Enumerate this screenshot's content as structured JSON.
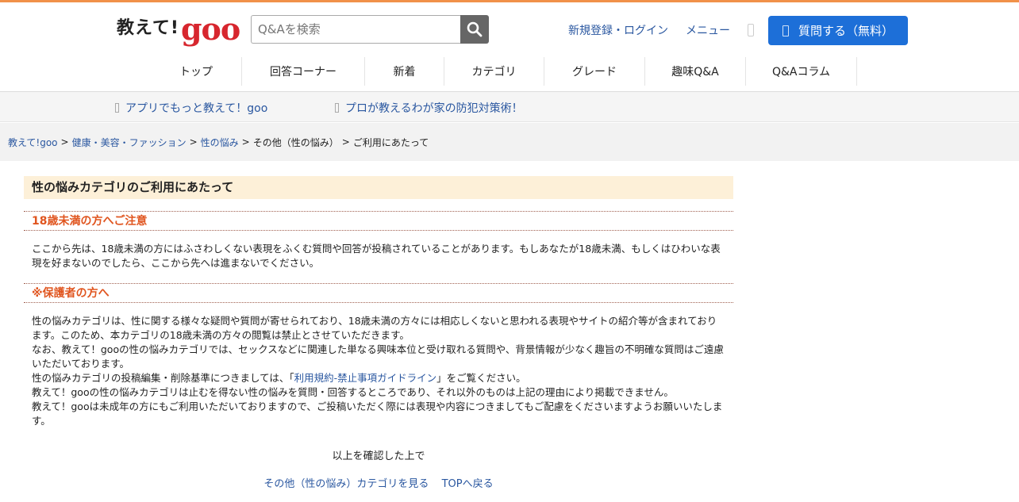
{
  "brand": {
    "logo_text": "教えて!",
    "logo_goo": "goo"
  },
  "search": {
    "placeholder": "Q&Aを検索"
  },
  "header": {
    "login_label": "新規登録・ログイン",
    "menu_label": "メニュー",
    "ask_label": "質問する（無料）"
  },
  "nav": {
    "items": [
      {
        "label": "トップ"
      },
      {
        "label": "回答コーナー"
      },
      {
        "label": "新着"
      },
      {
        "label": "カテゴリ"
      },
      {
        "label": "グレード"
      },
      {
        "label": "趣味Q&A"
      },
      {
        "label": "Q&Aコラム"
      }
    ]
  },
  "promo": {
    "app_label": "アプリでもっと教えて！goo",
    "column_label": "プロが教えるわが家の防犯対策術！"
  },
  "breadcrumb": {
    "items": [
      "教えて!goo",
      "健康・美容・ファッション",
      "性の悩み",
      "その他（性の悩み）",
      "ご利用にあたって"
    ],
    "sep": ">"
  },
  "main": {
    "title": "性の悩みカテゴリのご利用にあたって",
    "warning1_title": "18歳未満の方へご注意",
    "warning1_text": "ここから先は、18歳未満の方にはふさわしくない表現をふくむ質問や回答が投稿されていることがあります。もしあなたが18歳未満、もしくはひわいな表現を好まないのでしたら、ここから先へは進まないでください。",
    "warning2_title": "※保護者の方へ",
    "p1": "性の悩みカテゴリは、性に関する様々な疑問や質問が寄せられており、18歳未満の方々には相応しくないと思われる表現やサイトの紹介等が含まれております。このため、本カテゴリの18歳未満の方々の閲覧は禁止とさせていただきます。",
    "p2": "なお、教えて！gooの性の悩みカテゴリでは、セックスなどに関連した単なる興味本位と受け取れる質問や、背景情報が少なく趣旨の不明確な質問はご遠慮いただいております。",
    "p3_pre": "性の悩みカテゴリの投稿編集・削除基準につきましては、「",
    "p3_link": "利用規約-禁止事項ガイドライン",
    "p3_post": "」をご覧ください。",
    "p4": "教えて！gooの性の悩みカテゴリは止むを得ない性の悩みを質問・回答するところであり、それ以外のものは上記の理由により掲載できません。",
    "p5": "教えて！gooは未成年の方にもご利用いただいておりますので、ご投稿いただく際には表現や内容につきましてもご配慮をくださいますようお願いいたします。",
    "confirm_text": "以上を確認した上で",
    "view_category_link": "その他（性の悩み）カテゴリを見る",
    "back_top_link": "TOPへ戻る"
  }
}
